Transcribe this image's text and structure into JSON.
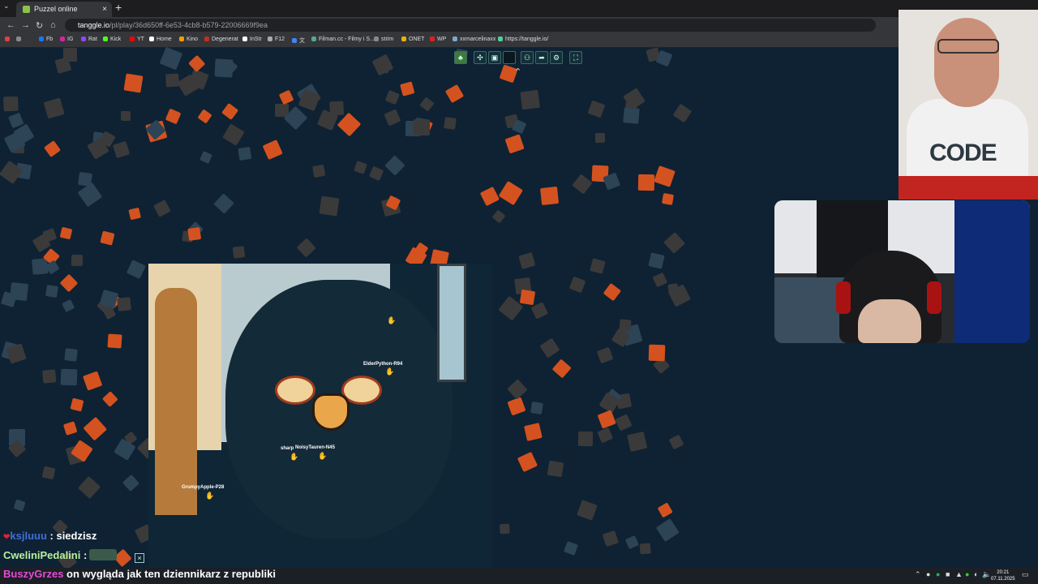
{
  "browser": {
    "tab_title": "Puzzel online",
    "url_host": "tanggle.io",
    "url_path": "/pl/play/36d650ff-6e53-4cb8-b579-22006669f9ea",
    "bookmarks": [
      "Fb",
      "IG",
      "Rat",
      "Kick",
      "YT",
      "Home",
      "Kino",
      "Degenerat",
      "InStr",
      "F12",
      "文",
      "Filman.cc - Filmy i S...",
      "strim",
      "ONET",
      "WP",
      "xxmarcelinaxx",
      "https://tanggle.io/"
    ]
  },
  "toolbar": {
    "icons": [
      "leaf-icon",
      "puzzle-icon",
      "image-icon",
      "box-icon",
      "players-icon",
      "share-icon",
      "settings-icon",
      "fullscreen-icon"
    ],
    "collapse": "⌃"
  },
  "players": {
    "p1": "ElderPython-R94",
    "p2": "NoisyTauren-N45",
    "p3": "GrumpyApple-P28",
    "p4": "sharp"
  },
  "chat": [
    {
      "user": "ksjluuu",
      "sep": " : ",
      "text": "siedzisz",
      "color": "#3f6fd8"
    },
    {
      "user": "CweliniPedalini",
      "sep": " : ",
      "text": "",
      "color": "#b7f0a0"
    },
    {
      "user": "BuszyGrzes",
      "sep": " ",
      "text": "on wygląda jak ten dziennikarz z republiki",
      "color": "#e64ad8"
    }
  ],
  "webcam": {
    "shirt_text": "CODE"
  },
  "taskbar": {
    "time": "20:21",
    "date": "07.11.2025"
  },
  "colors": {
    "background": "#0e2233",
    "piece_orange": "#d4521f",
    "piece_dark": "#3b3a3a",
    "piece_grey": "#2c4455"
  }
}
